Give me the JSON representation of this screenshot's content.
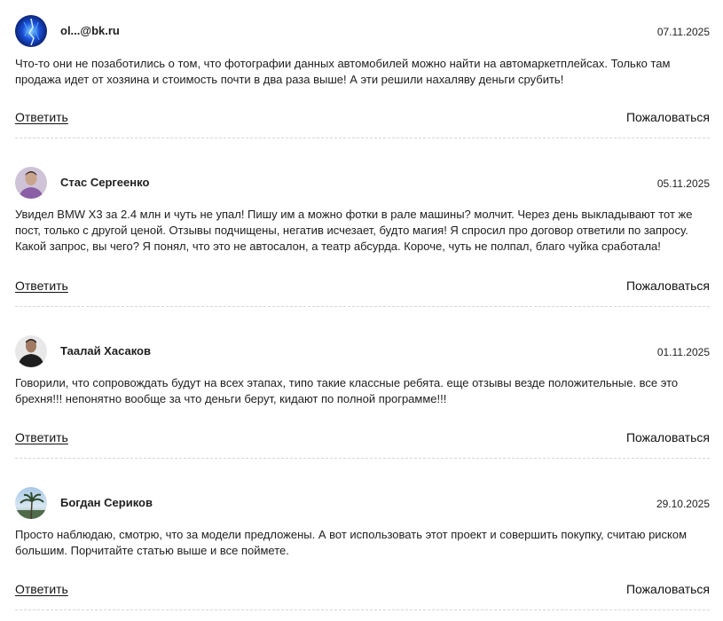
{
  "comments": [
    {
      "author": "ol...@bk.ru",
      "date": "07.11.2025",
      "text": "Что-то они не позаботились о том, что фотографии данных автомобилей можно найти на автомаркетплейсах. Только там продажа идет от хозяина и стоимость почти в два раза выше! А эти решили нахаляву деньги срубить!",
      "reply_label": "Ответить",
      "report_label": "Пожаловаться",
      "avatar_icon": "blue-abstract-avatar"
    },
    {
      "author": "Стас Сергеенко",
      "date": "05.11.2025",
      "text": "Увидел BMW X3 за 2.4 млн и чуть не упал! Пишу им а можно фотки в рале машины? молчит. Через день выкладывают тот же пост, только с другой ценой. Отзывы подчищены, негатив исчезает, будто магия! Я спросил про договор ответили по запросу. Какой запрос, вы чего? Я понял, что это не автосалон, а театр абсурда. Короче, чуть не полпал, благо чуйка сработала!",
      "reply_label": "Ответить",
      "report_label": "Пожаловаться",
      "avatar_icon": "man-photo-avatar"
    },
    {
      "author": "Таалай Хасаков",
      "date": "01.11.2025",
      "text": "Говорили, что сопровождать будут на всех этапах, типо такие классные ребята. еще отзывы везде положительные. все это брехня!!! непонятно вообще за что деньги берут, кидают по полной программе!!!",
      "reply_label": "Ответить",
      "report_label": "Пожаловаться",
      "avatar_icon": "dark-portrait-avatar"
    },
    {
      "author": "Богдан Сериков",
      "date": "29.10.2025",
      "text": "Просто наблюдаю, смотрю, что за модели предложены. А вот использовать этот проект и совершить покупку, считаю риском большим. Порчитайте статью выше и все поймете.",
      "reply_label": "Ответить",
      "report_label": "Пожаловаться",
      "avatar_icon": "palm-landscape-avatar"
    }
  ],
  "colors": {
    "text": "#1e1e1e",
    "divider": "#d6d6d6",
    "background": "#ffffff"
  }
}
